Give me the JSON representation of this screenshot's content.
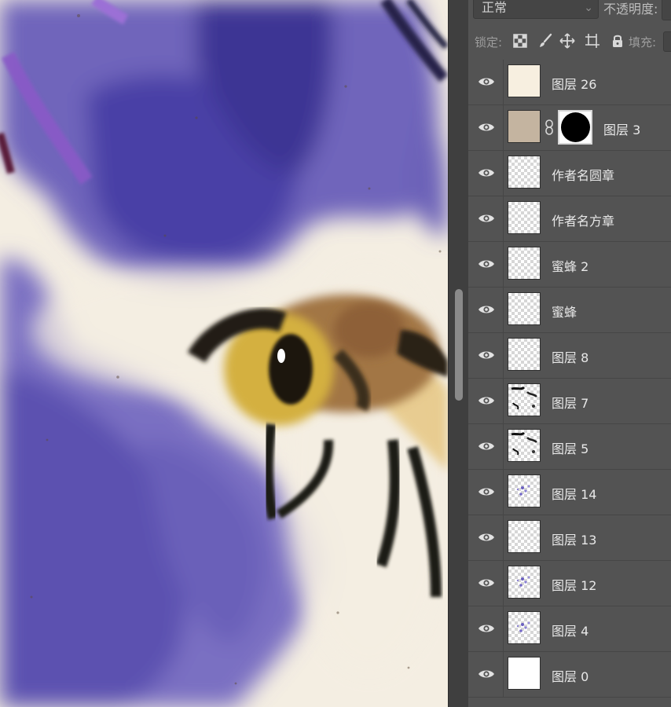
{
  "layers_panel": {
    "blend_mode": "正常",
    "opacity_label": "不透明度:",
    "lock_label": "锁定:",
    "fill_label": "填充:",
    "lock_icons": [
      "lock-transparent-pixels-icon",
      "lock-image-pixels-icon",
      "lock-position-icon",
      "lock-artboard-icon",
      "lock-all-icon"
    ],
    "layers": [
      {
        "name": "图层 26",
        "thumb": "cream",
        "visible": true
      },
      {
        "name": "图层 3",
        "thumb": "tan",
        "visible": true,
        "has_mask": true
      },
      {
        "name": "作者名圆章",
        "thumb": "transparent",
        "visible": true
      },
      {
        "name": "作者名方章",
        "thumb": "transparent",
        "visible": true
      },
      {
        "name": "蜜蜂 2",
        "thumb": "transparent",
        "visible": true
      },
      {
        "name": "蜜蜂",
        "thumb": "transparent",
        "visible": true
      },
      {
        "name": "图层 8",
        "thumb": "transparent",
        "visible": true
      },
      {
        "name": "图层 7",
        "thumb": "dark-strokes",
        "visible": true
      },
      {
        "name": "图层 5",
        "thumb": "dark-strokes",
        "visible": true
      },
      {
        "name": "图层 14",
        "thumb": "purple-dots",
        "visible": true
      },
      {
        "name": "图层 13",
        "thumb": "transparent",
        "visible": true
      },
      {
        "name": "图层 12",
        "thumb": "purple-dots",
        "visible": true
      },
      {
        "name": "图层 4",
        "thumb": "purple-dots",
        "visible": true
      },
      {
        "name": "图层 0",
        "thumb": "white",
        "visible": true
      }
    ]
  },
  "colors": {
    "panel_bg": "#535353",
    "canvas_paper": "#f4eee2",
    "wisteria_purple": "#6a5fb8",
    "bee_body": "#a57a45",
    "bee_yellow": "#d8b443"
  }
}
